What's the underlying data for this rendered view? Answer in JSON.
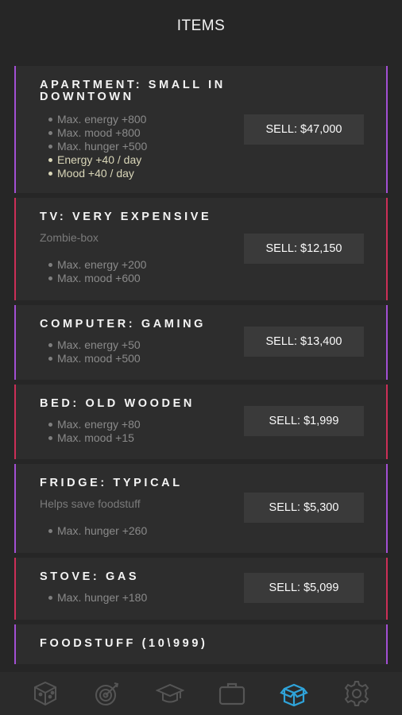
{
  "header": {
    "title": "ITEMS"
  },
  "items": [
    {
      "title": "APARTMENT: SMALL IN DOWNTOWN",
      "subtitle": "",
      "stats": [
        {
          "text": "Max. energy +800",
          "active": false
        },
        {
          "text": "Max. mood +800",
          "active": false
        },
        {
          "text": "Max. hunger +500",
          "active": false
        },
        {
          "text": "Energy +40 / day",
          "active": true
        },
        {
          "text": "Mood +40 / day",
          "active": true
        }
      ],
      "sell_label": "SELL: $47,000",
      "accent": "#a24fd4"
    },
    {
      "title": "TV: VERY EXPENSIVE",
      "subtitle": "Zombie-box",
      "stats": [
        {
          "text": "Max. energy +200",
          "active": false
        },
        {
          "text": "Max. mood +600",
          "active": false
        }
      ],
      "sell_label": "SELL: $12,150",
      "accent": "#cc2f57"
    },
    {
      "title": "COMPUTER: GAMING",
      "subtitle": "",
      "stats": [
        {
          "text": "Max. energy +50",
          "active": false
        },
        {
          "text": "Max. mood +500",
          "active": false
        }
      ],
      "sell_label": "SELL: $13,400",
      "accent": "#a24fd4"
    },
    {
      "title": "BED: OLD WOODEN",
      "subtitle": "",
      "stats": [
        {
          "text": "Max. energy +80",
          "active": false
        },
        {
          "text": "Max. mood +15",
          "active": false
        }
      ],
      "sell_label": "SELL: $1,999",
      "accent": "#cc2f57"
    },
    {
      "title": "FRIDGE: TYPICAL",
      "subtitle": "Helps save foodstuff",
      "stats": [
        {
          "text": "Max. hunger +260",
          "active": false
        }
      ],
      "sell_label": "SELL: $5,300",
      "accent": "#a24fd4"
    },
    {
      "title": "STOVE: GAS",
      "subtitle": "",
      "stats": [
        {
          "text": "Max. hunger +180",
          "active": false
        }
      ],
      "sell_label": "SELL: $5,099",
      "accent": "#cc2f57"
    },
    {
      "title": "FOODSTUFF (10\\999)",
      "subtitle": "",
      "stats": [],
      "sell_label": "",
      "accent": "#a24fd4"
    }
  ],
  "nav": {
    "tabs": [
      {
        "icon": "dice-icon",
        "active": false
      },
      {
        "icon": "target-icon",
        "active": false
      },
      {
        "icon": "graduation-cap-icon",
        "active": false
      },
      {
        "icon": "briefcase-icon",
        "active": false
      },
      {
        "icon": "box-icon",
        "active": true
      },
      {
        "icon": "gear-icon",
        "active": false
      }
    ],
    "inactive_color": "#555555",
    "active_color": "#2fa3d9"
  }
}
